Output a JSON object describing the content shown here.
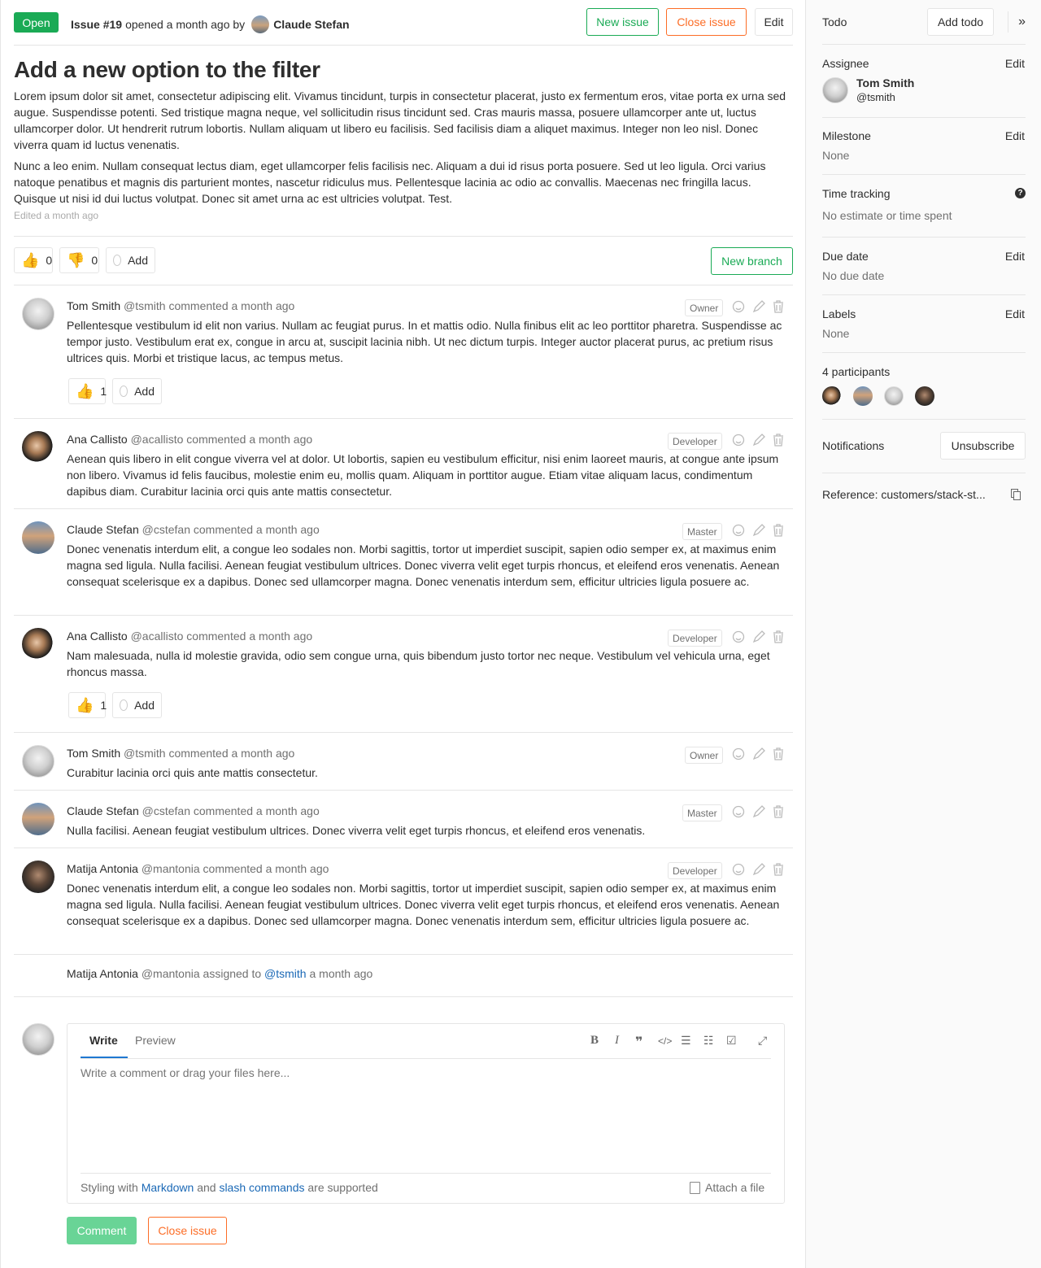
{
  "header": {
    "status": "Open",
    "issue_ref": "Issue #19",
    "opened_text": "opened a month ago by",
    "author": "Claude Stefan",
    "new_issue": "New issue",
    "close_issue": "Close issue",
    "edit": "Edit"
  },
  "issue": {
    "title": "Add a new option to the filter",
    "paragraphs": [
      "Lorem ipsum dolor sit amet, consectetur adipiscing elit. Vivamus tincidunt, turpis in consectetur placerat, justo ex fermentum eros, vitae porta ex urna sed augue. Suspendisse potenti. Sed tristique magna neque, vel sollicitudin risus tincidunt sed. Cras mauris massa, posuere ullamcorper ante ut, luctus ullamcorper dolor. Ut hendrerit rutrum lobortis. Nullam aliquam ut libero eu facilisis. Sed facilisis diam a aliquet maximus. Integer non leo nisl. Donec viverra quam id luctus venenatis.",
      "Nunc a leo enim. Nullam consequat lectus diam, eget ullamcorper felis facilisis nec. Aliquam a dui id risus porta posuere. Sed ut leo ligula. Orci varius natoque penatibus et magnis dis parturient montes, nascetur ridiculus mus. Pellentesque lacinia ac odio ac convallis. Maecenas nec fringilla lacus. Quisque ut nisi id dui luctus volutpat. Donec sit amet urna ac est ultricies volutpat. Test."
    ],
    "edited": "Edited a month ago",
    "thumbs_up": "0",
    "thumbs_down": "0",
    "add_label": "Add",
    "new_branch": "New branch"
  },
  "notes": [
    {
      "author": "Tom Smith",
      "handle": "@tsmith",
      "meta": "commented a month ago",
      "role": "Owner",
      "body": "Pellentesque vestibulum id elit non varius. Nullam ac feugiat purus. In et mattis odio. Nulla finibus elit ac leo porttitor pharetra. Suspendisse ac tempor justo. Vestibulum erat ex, congue in arcu at, suscipit lacinia nibh. Ut nec dictum turpis. Integer auctor placerat purus, ac pretium risus ultrices quis. Morbi et tristique lacus, ac tempus metus.",
      "thumbs": "1",
      "add": "Add"
    },
    {
      "author": "Ana Callisto",
      "handle": "@acallisto",
      "meta": "commented a month ago",
      "role": "Developer",
      "body": "Aenean quis libero in elit congue viverra vel at dolor. Ut lobortis, sapien eu vestibulum efficitur, nisi enim laoreet mauris, at congue ante ipsum non libero. Vivamus id felis faucibus, molestie enim eu, mollis quam. Aliquam in porttitor augue. Etiam vitae aliquam lacus, condimentum dapibus diam. Curabitur lacinia orci quis ante mattis consectetur."
    },
    {
      "author": "Claude Stefan",
      "handle": "@cstefan",
      "meta": "commented a month ago",
      "role": "Master",
      "body": "Donec venenatis interdum elit, a congue leo sodales non. Morbi sagittis, tortor ut imperdiet suscipit, sapien odio semper ex, at maximus enim magna sed ligula. Nulla facilisi. Aenean feugiat vestibulum ultrices. Donec viverra velit eget turpis rhoncus, et eleifend eros venenatis. Aenean consequat scelerisque ex a dapibus. Donec sed ullamcorper magna. Donec venenatis interdum sem, efficitur ultricies ligula posuere ac."
    },
    {
      "author": "Ana Callisto",
      "handle": "@acallisto",
      "meta": "commented a month ago",
      "role": "Developer",
      "body": "Nam malesuada, nulla id molestie gravida, odio sem congue urna, quis bibendum justo tortor nec neque. Vestibulum vel vehicula urna, eget rhoncus massa.",
      "thumbs": "1",
      "add": "Add"
    },
    {
      "author": "Tom Smith",
      "handle": "@tsmith",
      "meta": "commented a month ago",
      "role": "Owner",
      "body": "Curabitur lacinia orci quis ante mattis consectetur."
    },
    {
      "author": "Claude Stefan",
      "handle": "@cstefan",
      "meta": "commented a month ago",
      "role": "Master",
      "body": "Nulla facilisi. Aenean feugiat vestibulum ultrices. Donec viverra velit eget turpis rhoncus, et eleifend eros venenatis."
    },
    {
      "author": "Matija Antonia",
      "handle": "@mantonia",
      "meta": "commented a month ago",
      "role": "Developer",
      "body": "Donec venenatis interdum elit, a congue leo sodales non. Morbi sagittis, tortor ut imperdiet suscipit, sapien odio semper ex, at maximus enim magna sed ligula. Nulla facilisi. Aenean feugiat vestibulum ultrices. Donec viverra velit eget turpis rhoncus, et eleifend eros venenatis. Aenean consequat scelerisque ex a dapibus. Donec sed ullamcorper magna. Donec venenatis interdum sem, efficitur ultricies ligula posuere ac."
    }
  ],
  "system_note": {
    "author": "Matija Antonia",
    "handle": "@mantonia",
    "action": "assigned to",
    "target": "@tsmith",
    "time": "a month ago"
  },
  "editor": {
    "write_tab": "Write",
    "preview_tab": "Preview",
    "placeholder": "Write a comment or drag your files here...",
    "footer_prefix": "Styling with",
    "markdown_link": "Markdown",
    "and": "and",
    "slash_link": "slash commands",
    "footer_suffix": "are supported",
    "attach": "Attach a file",
    "comment_btn": "Comment",
    "close_btn": "Close issue"
  },
  "sidebar": {
    "todo_label": "Todo",
    "add_todo": "Add todo",
    "assignee_label": "Assignee",
    "assignee_name": "Tom Smith",
    "assignee_handle": "@tsmith",
    "edit": "Edit",
    "milestone_label": "Milestone",
    "milestone_value": "None",
    "time_label": "Time tracking",
    "time_value": "No estimate or time spent",
    "due_label": "Due date",
    "due_value": "No due date",
    "labels_label": "Labels",
    "labels_value": "None",
    "participants_label": "4 participants",
    "notifications_label": "Notifications",
    "unsubscribe": "Unsubscribe",
    "reference": "Reference: customers/stack-st..."
  },
  "colors": {
    "green": "#1aaa55",
    "orange": "#fc6d26",
    "link": "#1b69b6"
  }
}
